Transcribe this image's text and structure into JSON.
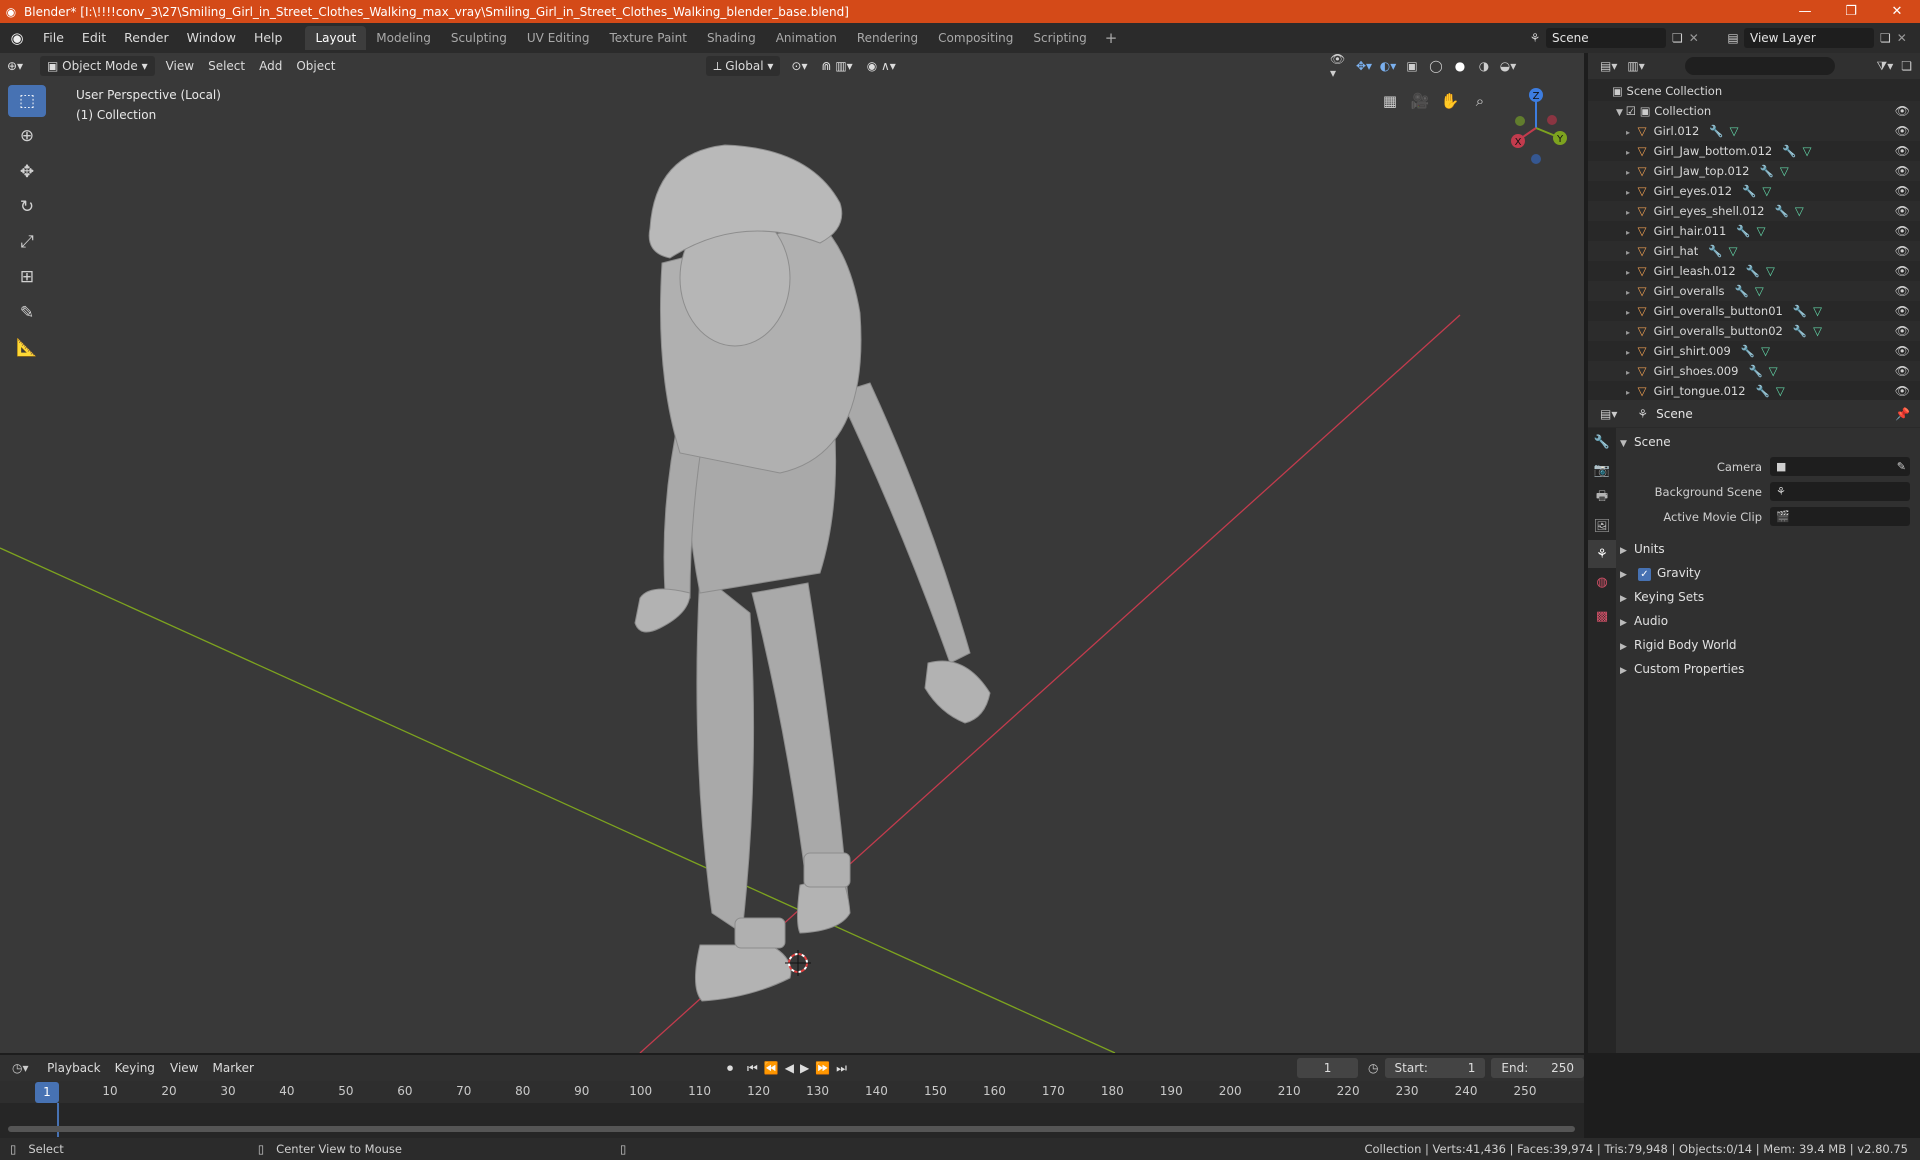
{
  "window": {
    "title": "Blender* [I:\\!!!!conv_3\\27\\Smiling_Girl_in_Street_Clothes_Walking_max_vray\\Smiling_Girl_in_Street_Clothes_Walking_blender_base.blend]",
    "minimize": "—",
    "maximize": "❐",
    "close": "✕"
  },
  "menubar": {
    "items": [
      "File",
      "Edit",
      "Render",
      "Window",
      "Help"
    ],
    "workspaces": [
      "Layout",
      "Modeling",
      "Sculpting",
      "UV Editing",
      "Texture Paint",
      "Shading",
      "Animation",
      "Rendering",
      "Compositing",
      "Scripting"
    ],
    "active_workspace": "Layout",
    "add_tab": "+",
    "scene_name": "Scene",
    "view_layer": "View Layer"
  },
  "viewport": {
    "mode": "Object Mode",
    "menus": [
      "View",
      "Select",
      "Add",
      "Object"
    ],
    "transform_orientation": "Global",
    "info_line1": "User Perspective (Local)",
    "info_line2": "(1) Collection",
    "gizmo_axes": [
      "X",
      "Y",
      "Z"
    ]
  },
  "outliner": {
    "search_placeholder": "",
    "scene_collection": "Scene Collection",
    "collection": "Collection",
    "objects": [
      "Girl.012",
      "Girl_Jaw_bottom.012",
      "Girl_Jaw_top.012",
      "Girl_eyes.012",
      "Girl_eyes_shell.012",
      "Girl_hair.011",
      "Girl_hat",
      "Girl_leash.012",
      "Girl_overalls",
      "Girl_overalls_button01",
      "Girl_overalls_button02",
      "Girl_shirt.009",
      "Girl_shoes.009",
      "Girl_tongue.012"
    ]
  },
  "properties": {
    "context": "Scene",
    "scene_panel": "Scene",
    "camera_label": "Camera",
    "background_scene_label": "Background Scene",
    "active_movie_clip_label": "Active Movie Clip",
    "panels": [
      "Units",
      "Gravity",
      "Keying Sets",
      "Audio",
      "Rigid Body World",
      "Custom Properties"
    ],
    "gravity_checked": true
  },
  "timeline": {
    "menus": [
      "Playback",
      "Keying",
      "View",
      "Marker"
    ],
    "current_frame": "1",
    "start_label": "Start:",
    "start": "1",
    "end_label": "End:",
    "end": "250",
    "ruler": [
      "1",
      "10",
      "20",
      "30",
      "40",
      "50",
      "60",
      "70",
      "80",
      "90",
      "100",
      "110",
      "120",
      "130",
      "140",
      "150",
      "160",
      "170",
      "180",
      "190",
      "200",
      "210",
      "220",
      "230",
      "240",
      "250"
    ]
  },
  "statusbar": {
    "left_action": "Select",
    "middle_action": "Center View to Mouse",
    "stats": "Collection | Verts:41,436 | Faces:39,974 | Tris:79,948 | Objects:0/14 | Mem: 39.4 MB | v2.80.75"
  },
  "colors": {
    "titlebar": "#d44a18",
    "accent": "#4772b3",
    "object_icon": "#f0a052",
    "x_axis": "#c23b4d",
    "y_axis": "#7da31f",
    "z_axis": "#3d7de0"
  }
}
